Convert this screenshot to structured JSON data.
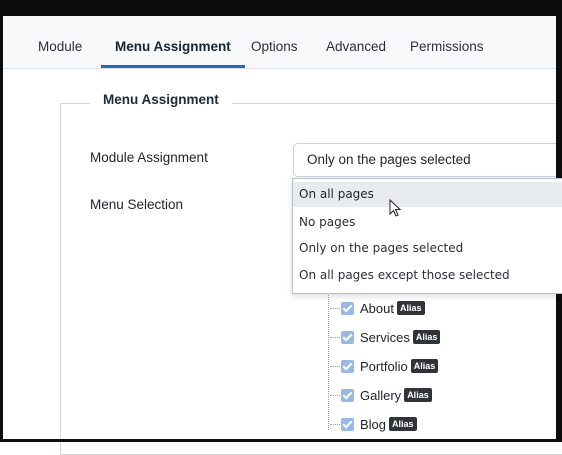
{
  "tabs": [
    {
      "label": "Module"
    },
    {
      "label": "Menu Assignment"
    },
    {
      "label": "Options"
    },
    {
      "label": "Advanced"
    },
    {
      "label": "Permissions"
    }
  ],
  "active_tab": "Menu Assignment",
  "fieldset": {
    "legend": "Menu Assignment"
  },
  "module_assignment": {
    "label": "Module Assignment",
    "selected": "Only on the pages selected",
    "options": [
      "On all pages",
      "No pages",
      "Only on the pages selected",
      "On all pages except those selected"
    ],
    "hovered": "On all pages"
  },
  "menu_selection": {
    "label": "Menu Selection"
  },
  "menu_items": [
    {
      "label": "About",
      "badge": "Alias",
      "checked": true
    },
    {
      "label": "Services",
      "badge": "Alias",
      "checked": true
    },
    {
      "label": "Portfolio",
      "badge": "Alias",
      "checked": true
    },
    {
      "label": "Gallery",
      "badge": "Alias",
      "checked": true
    },
    {
      "label": "Blog",
      "badge": "Alias",
      "checked": true
    }
  ],
  "colors": {
    "active_tab_underline": "#2a69b8",
    "checkbox": "#9ab8e6",
    "badge_bg": "#303438"
  }
}
